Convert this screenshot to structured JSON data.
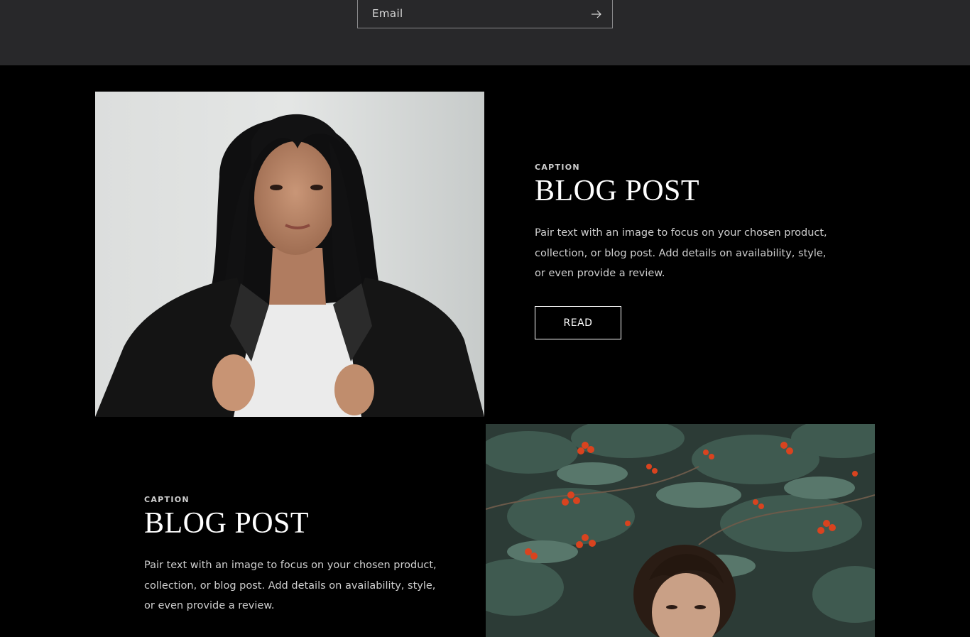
{
  "newsletter": {
    "email_placeholder": "Email",
    "submit_icon": "arrow-right-icon"
  },
  "posts": [
    {
      "caption": "CAPTION",
      "title": "BLOG POST",
      "body": "Pair text with an image to focus on your chosen product, collection, or blog post. Add details on availability, style, or even provide a review.",
      "button_label": "READ",
      "image": "woman-in-leather-jacket-photo"
    },
    {
      "caption": "CAPTION",
      "title": "BLOG POST",
      "body": "Pair text with an image to focus on your chosen product, collection, or blog post. Add details on availability, style, or even provide a review.",
      "image": "woman-under-rowan-tree-photo"
    }
  ],
  "colors": {
    "newsletter_bg": "#28282a",
    "page_bg": "#000000",
    "text_primary": "#ffffff",
    "text_secondary": "#cfcfcf"
  }
}
